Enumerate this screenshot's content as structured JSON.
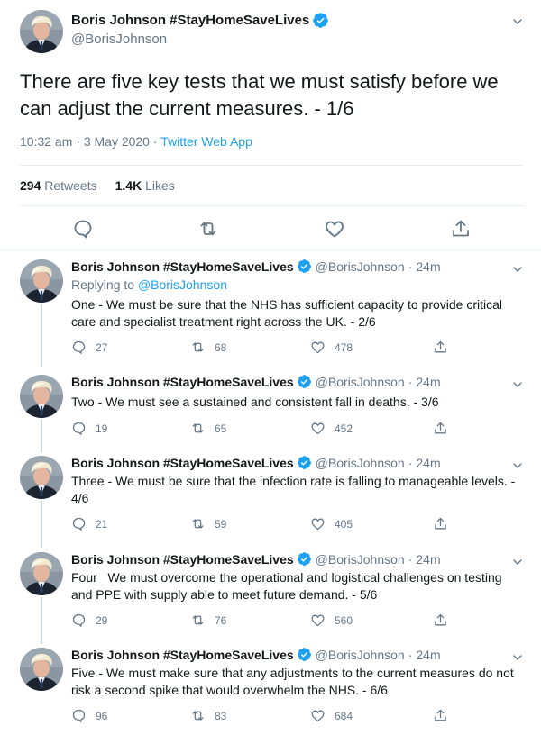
{
  "main_tweet": {
    "author_name": "Boris Johnson #StayHomeSaveLives",
    "author_handle": "@BorisJohnson",
    "text": "There are five key tests that we must satisfy before we can adjust the current measures. - 1/6",
    "timestamp": "10:32 am · 3 May 2020",
    "separator": " · ",
    "source": "Twitter Web App",
    "retweets_count": "294",
    "retweets_label": "Retweets",
    "likes_count": "1.4K",
    "likes_label": "Likes"
  },
  "replies": [
    {
      "author_name": "Boris Johnson #StayHomeSaveLives",
      "author_handle": "@BorisJohnson",
      "dot": "·",
      "time": "24m",
      "replying_prefix": "Replying to ",
      "replying_to": "@BorisJohnson",
      "text": "One - We must be sure that the NHS has sufficient capacity to provide critical care and specialist treatment right across the UK. - 2/6",
      "reply_count": "27",
      "retweet_count": "68",
      "like_count": "478"
    },
    {
      "author_name": "Boris Johnson #StayHomeSaveLives",
      "author_handle": "@BorisJohnson",
      "dot": "·",
      "time": "24m",
      "text": "Two - We must see a sustained and consistent fall in deaths. - 3/6",
      "reply_count": "19",
      "retweet_count": "65",
      "like_count": "452"
    },
    {
      "author_name": "Boris Johnson #StayHomeSaveLives",
      "author_handle": "@BorisJohnson",
      "dot": "·",
      "time": "24m",
      "text": "Three - We must be sure that the infection rate is falling to manageable levels. - 4/6",
      "reply_count": "21",
      "retweet_count": "59",
      "like_count": "405"
    },
    {
      "author_name": "Boris Johnson #StayHomeSaveLives",
      "author_handle": "@BorisJohnson",
      "dot": "·",
      "time": "24m",
      "text": "Four   We must overcome the operational and logistical challenges on testing and PPE with supply able to meet future demand. - 5/6",
      "reply_count": "29",
      "retweet_count": "76",
      "like_count": "560"
    },
    {
      "author_name": "Boris Johnson #StayHomeSaveLives",
      "author_handle": "@BorisJohnson",
      "dot": "·",
      "time": "24m",
      "text": "Five - We must make sure that any adjustments to the current measures do not risk a second spike that would overwhelm the NHS. - 6/6",
      "reply_count": "96",
      "retweet_count": "83",
      "like_count": "684"
    }
  ],
  "colors": {
    "accent": "#1da1f2",
    "text_primary": "#14171a",
    "text_secondary": "#657786",
    "divider": "#e6ecf0",
    "thread_line": "#ccd6dd"
  },
  "icons": [
    "verified-badge-icon",
    "chevron-down-icon",
    "reply-icon",
    "retweet-icon",
    "like-icon",
    "share-icon"
  ]
}
